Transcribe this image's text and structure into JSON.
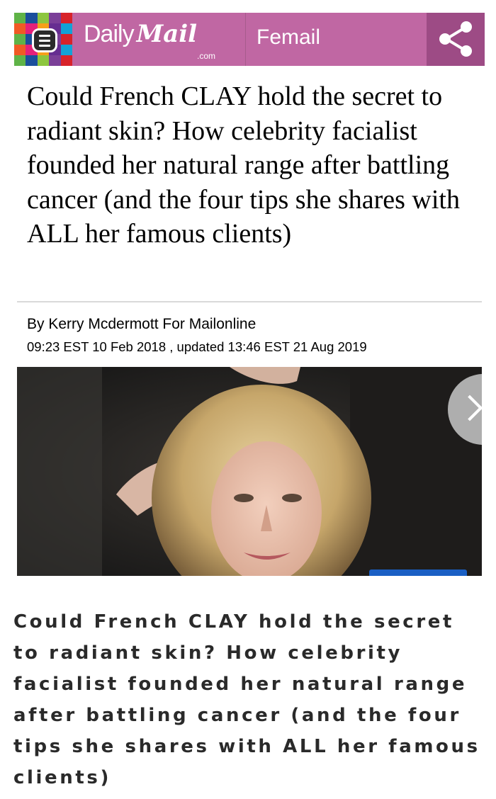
{
  "header": {
    "logo_daily": "Daily",
    "logo_mail": "Mail",
    "logo_com": ".com",
    "section": "Femail",
    "menu_icon": "hamburger-menu-icon",
    "share_icon": "share-icon",
    "colors": {
      "bar": "#c067a3",
      "share_bg": "#9d4b85",
      "mosaic": [
        "#1b4f9c",
        "#d8232a",
        "#f6a01a",
        "#5fb347",
        "#7b3f98",
        "#e6207a",
        "#13a2d6",
        "#8dc63f",
        "#f15a24",
        "#662d91"
      ]
    }
  },
  "article": {
    "headline": "Could French CLAY hold the secret to radiant skin? How celebrity facialist founded her natural range after battling cancer (and the four tips she shares with ALL her famous clients)",
    "byline": "By Kerry Mcdermott For Mailonline",
    "dateline": "09:23 EST 10 Feb 2018 , updated 13:46 EST 21 Aug 2019"
  },
  "gallery": {
    "next_icon": "chevron-right-icon"
  },
  "caption": {
    "text": "Could French CLAY hold the secret to radiant skin? How celebrity facialist founded her natural range after battling cancer (and the four tips she shares with ALL her famous clients)"
  }
}
